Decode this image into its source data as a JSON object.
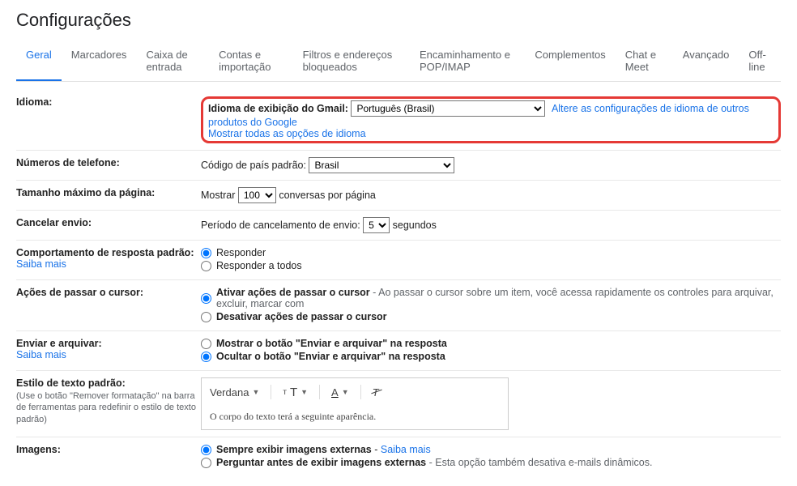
{
  "page_title": "Configurações",
  "tabs": [
    "Geral",
    "Marcadores",
    "Caixa de entrada",
    "Contas e importação",
    "Filtros e endereços bloqueados",
    "Encaminhamento e POP/IMAP",
    "Complementos",
    "Chat e Meet",
    "Avançado",
    "Off-line"
  ],
  "language": {
    "label": "Idioma:",
    "display_label": "Idioma de exibição do Gmail:",
    "selected": "Português (Brasil)",
    "change_link": "Altere as configurações de idioma de outros produtos do Google",
    "show_all": "Mostrar todas as opções de idioma"
  },
  "phone": {
    "label": "Números de telefone:",
    "code_label": "Código de país padrão:",
    "selected": "Brasil"
  },
  "page_size": {
    "label": "Tamanho máximo da página:",
    "show": "Mostrar",
    "value": "100",
    "suffix": "conversas por página"
  },
  "undo": {
    "label": "Cancelar envio:",
    "period_label": "Período de cancelamento de envio:",
    "value": "5",
    "suffix": "segundos"
  },
  "reply_behavior": {
    "label": "Comportamento de resposta padrão:",
    "learn_more": "Saiba mais",
    "opt1": "Responder",
    "opt2": "Responder a todos"
  },
  "hover": {
    "label": "Ações de passar o cursor:",
    "opt1_bold": "Ativar ações de passar o cursor",
    "opt1_desc": " - Ao passar o cursor sobre um item, você acessa rapidamente os controles para arquivar, excluir, marcar com",
    "opt2": "Desativar ações de passar o cursor"
  },
  "send_archive": {
    "label": "Enviar e arquivar:",
    "learn_more": "Saiba mais",
    "opt1": "Mostrar o botão \"Enviar e arquivar\" na resposta",
    "opt2": "Ocultar o botão \"Enviar e arquivar\" na resposta"
  },
  "text_style": {
    "label": "Estilo de texto padrão:",
    "sub": "(Use o botão \"Remover formatação\" na barra de ferramentas para redefinir o estilo de texto padrão)",
    "font_name": "Verdana",
    "preview": "O corpo do texto terá a seguinte aparência."
  },
  "images": {
    "label": "Imagens:",
    "opt1_bold": "Sempre exibir imagens externas",
    "learn_more": "Saiba mais",
    "opt2_bold": "Perguntar antes de exibir imagens externas",
    "opt2_desc": " - Esta opção também desativa e-mails dinâmicos."
  }
}
